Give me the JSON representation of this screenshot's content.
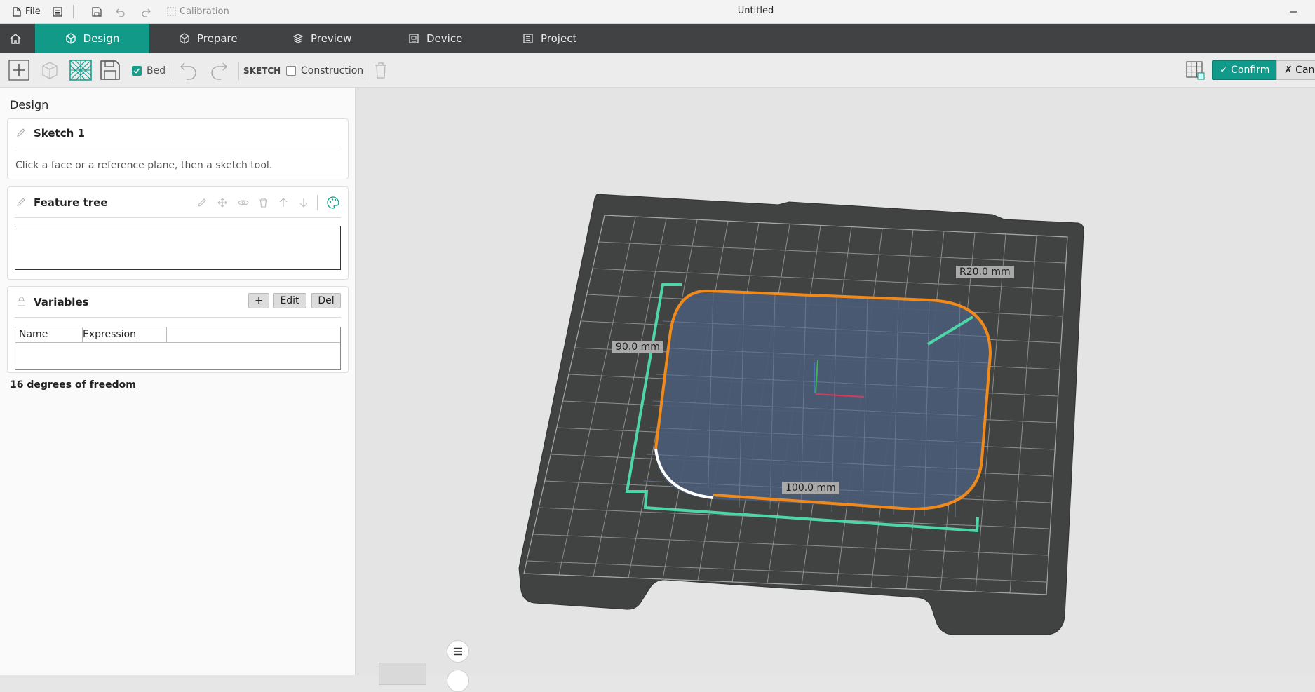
{
  "titlebar": {
    "file_label": "File",
    "calibration_label": "Calibration",
    "window_title": "Untitled"
  },
  "nav": {
    "tabs": [
      {
        "label": "Design",
        "icon": "cube-icon",
        "active": true
      },
      {
        "label": "Prepare",
        "icon": "box-icon",
        "active": false
      },
      {
        "label": "Preview",
        "icon": "layers-icon",
        "active": false
      },
      {
        "label": "Device",
        "icon": "device-icon",
        "active": false
      },
      {
        "label": "Project",
        "icon": "list-icon",
        "active": false
      }
    ]
  },
  "toolbar": {
    "bed_label": "Bed",
    "bed_checked": true,
    "sketch_label": "SKETCH",
    "construction_label": "Construction",
    "construction_checked": false,
    "confirm_label": "✓ Confirm",
    "cancel_label": "✗ Cancel"
  },
  "left_panel": {
    "title": "Design",
    "sketch": {
      "name": "Sketch 1",
      "hint": "Click a face or a reference plane, then a sketch tool."
    },
    "feature_tree": {
      "title": "Feature tree"
    },
    "variables": {
      "title": "Variables",
      "add_label": "+",
      "edit_label": "Edit",
      "del_label": "Del",
      "columns": [
        "Name",
        "Expression"
      ]
    },
    "dof_text": "16 degrees of freedom"
  },
  "viewport": {
    "dimensions": {
      "radius": "R20.0 mm",
      "height": "90.0 mm",
      "width": "100.0 mm"
    }
  },
  "colors": {
    "accent": "#119a88",
    "nav_bg": "#404243",
    "sketch_orange": "#f08a1c",
    "construction_green": "#4fd6a8",
    "bed_dark": "#3f4140"
  }
}
